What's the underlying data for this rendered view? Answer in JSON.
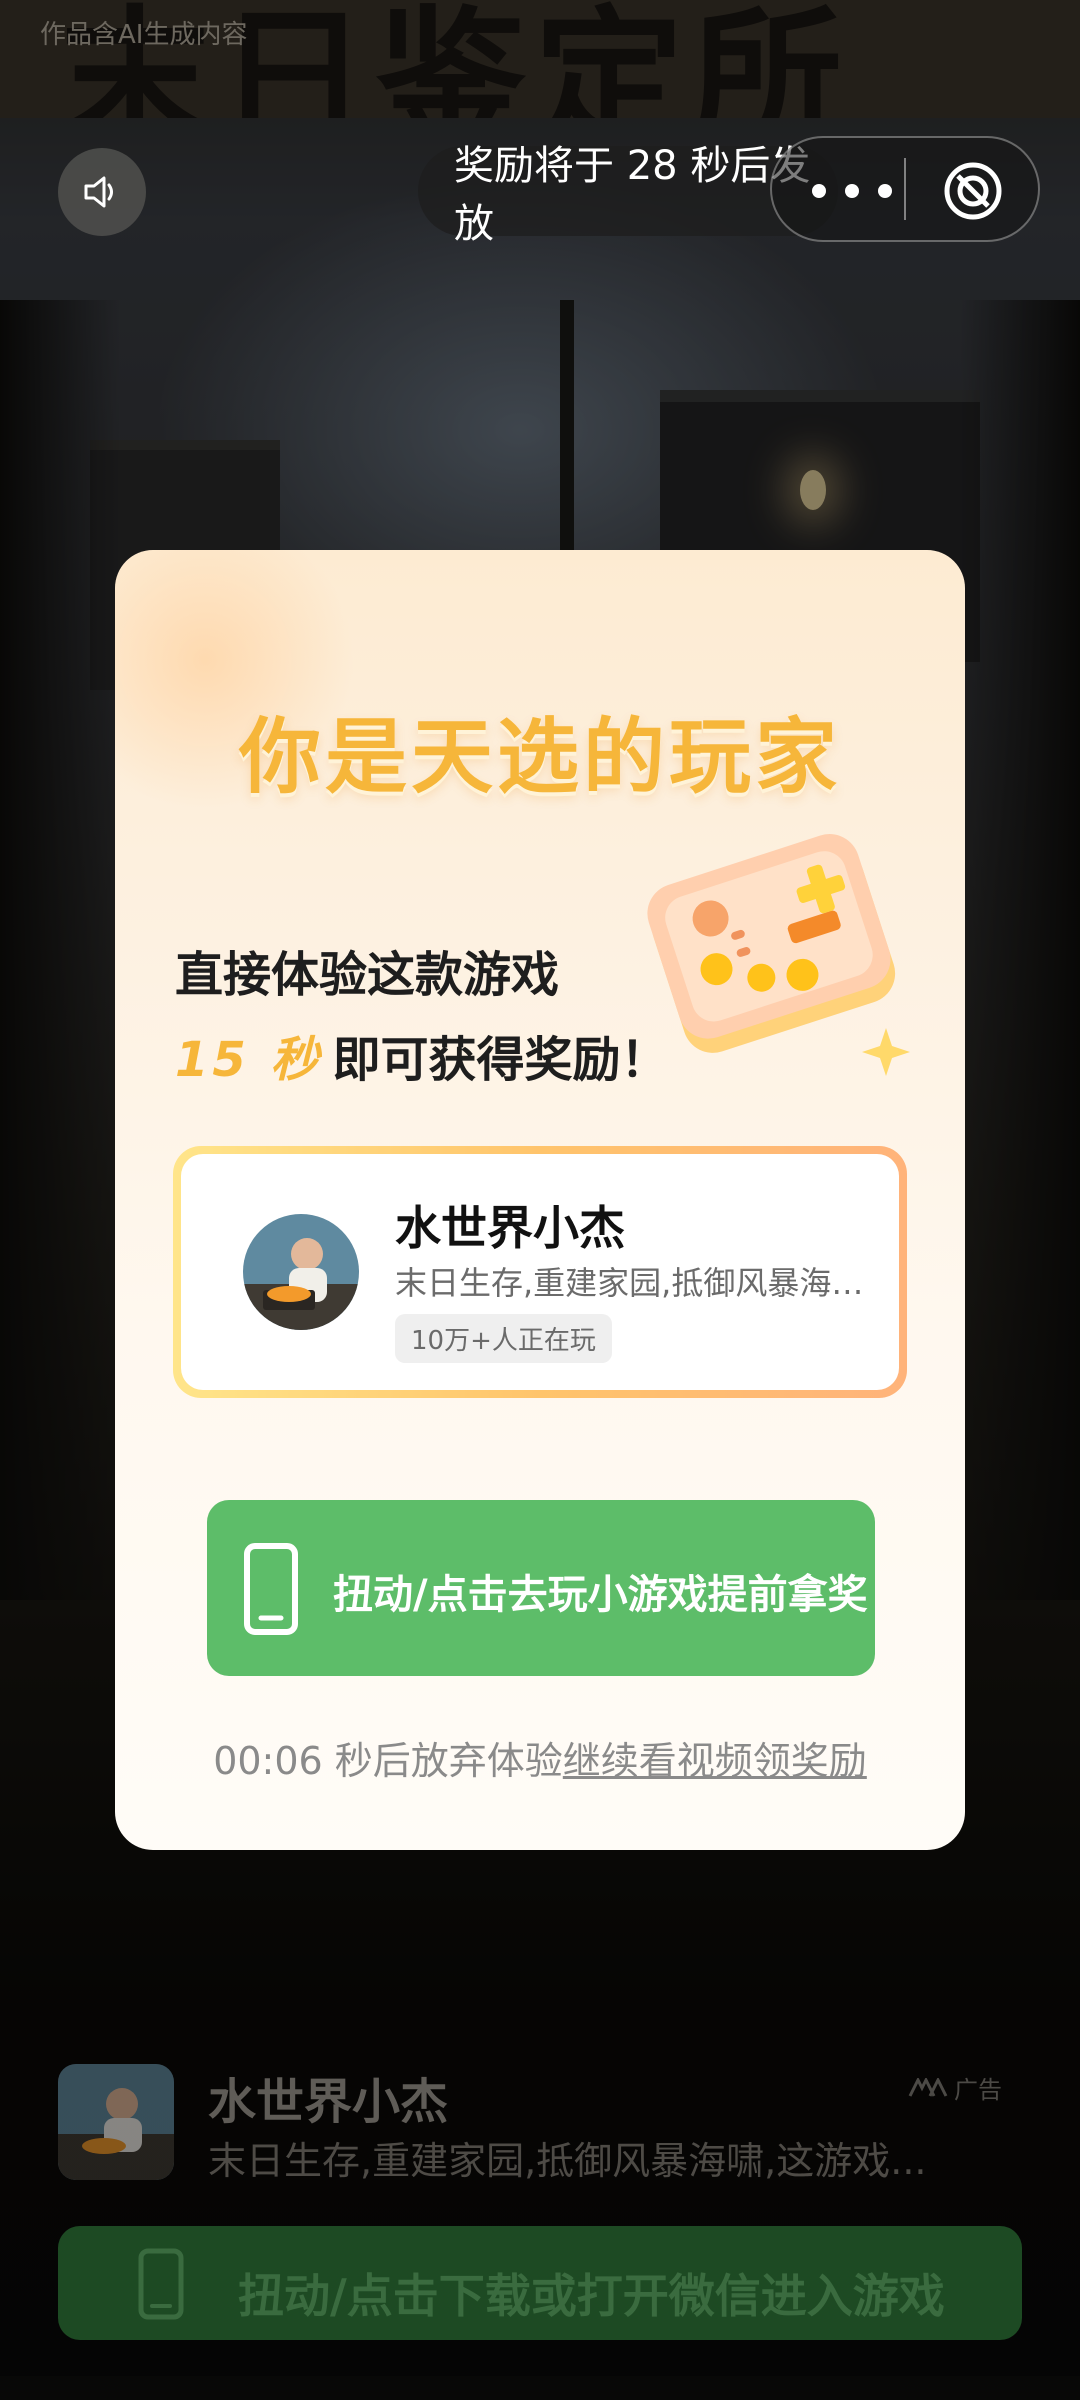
{
  "top": {
    "title_sign": "末日鉴定所",
    "ai_label": "作品含AI生成内容",
    "reward_timer": "奖励将于 28 秒后发放",
    "icons": {
      "sound": "speaker-icon",
      "more": "more-dots-icon",
      "close": "close-circle-icon"
    }
  },
  "modal": {
    "title": "你是天选的玩家",
    "experience_line1": "直接体验这款游戏",
    "experience_seconds": "15 秒",
    "experience_line2": "即可获得奖励！",
    "game": {
      "name": "水世界小杰",
      "description": "末日生存,重建家园,抵御风暴海啸,这游戏...",
      "players": "10万+人正在玩"
    },
    "play_button": "扭动/点击去玩小游戏提前拿奖",
    "countdown_time": "00:06",
    "countdown_text": " 秒后放弃体验",
    "continue_link": "继续看视频领奖励"
  },
  "ad": {
    "name": "水世界小杰",
    "description": "末日生存,重建家园,抵御风暴海啸,这游戏...",
    "tag": "广告",
    "download_button": "扭动/点击下载或打开微信进入游戏"
  },
  "colors": {
    "accent_orange": "#f6b63a",
    "play_green": "#5dbd69",
    "download_green_dim": "#1d4a23"
  }
}
